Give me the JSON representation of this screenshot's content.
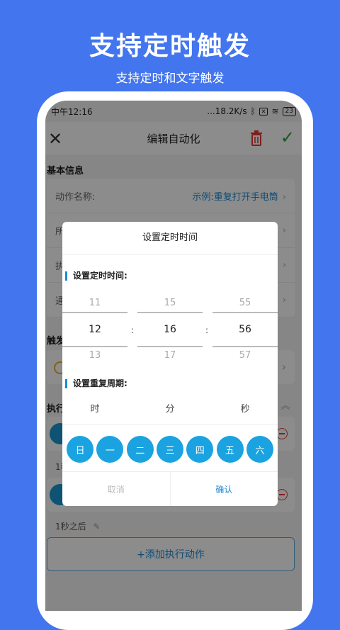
{
  "promo": {
    "title": "支持定时触发",
    "subtitle": "支持定时和文字触发"
  },
  "status": {
    "time": "中午12:16",
    "speed": "...18.2K/s",
    "battery": "23"
  },
  "appbar": {
    "title": "编辑自动化"
  },
  "basic": {
    "title": "基本信息",
    "rows": [
      {
        "label": "动作名称:",
        "value": "示例:重复打开手电筒"
      },
      {
        "label": "所",
        "value": ""
      },
      {
        "label": "执",
        "value": ""
      },
      {
        "label": "通",
        "value": ""
      }
    ]
  },
  "trigger": {
    "title": "触发"
  },
  "execute": {
    "title": "执行",
    "delay1": "1秒",
    "delay2": "1秒之后"
  },
  "add_button": "+添加执行动作",
  "dialog": {
    "title": "设置定时时间",
    "time_label": "设置定时时间:",
    "hours": {
      "prev": "11",
      "sel": "12",
      "next": "13"
    },
    "minutes": {
      "prev": "15",
      "sel": "16",
      "next": "17"
    },
    "seconds": {
      "prev": "55",
      "sel": "56",
      "next": "57"
    },
    "repeat_label": "设置重复周期:",
    "units": [
      "时",
      "分",
      "秒"
    ],
    "days": [
      "日",
      "一",
      "二",
      "三",
      "四",
      "五",
      "六"
    ],
    "cancel": "取消",
    "confirm": "确认"
  },
  "colors": {
    "accent": "#1aa3e0",
    "background": "#4275ee",
    "confirm": "#2a9d3a",
    "delete": "#e53935"
  }
}
